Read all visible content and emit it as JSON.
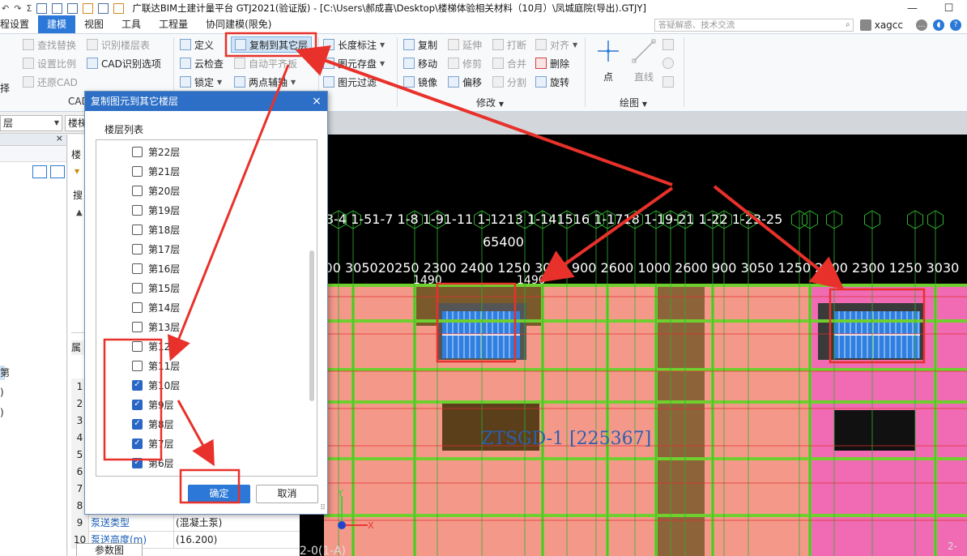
{
  "titlebar": {
    "quick_access": [
      "↶",
      "↷",
      "Σ"
    ],
    "title": "广联达BIM土建计量平台 GTJ2021(验证版) - [C:\\Users\\郝成喜\\Desktop\\楼梯体验相关材料（10月）\\凤城庭院(导出).GTJY]",
    "minimize": "—",
    "maximize": "☐"
  },
  "menubar": {
    "items": [
      "程设置",
      "建模",
      "视图",
      "工具",
      "工程量",
      "协同建模(限免)"
    ],
    "active": "建模",
    "search_placeholder": "答疑解惑、技术交流",
    "search_icon": "search-icon",
    "username": "xagcc"
  },
  "ribbon": {
    "left_partial": [
      "择",
      "择"
    ],
    "cad_group": {
      "find_replace": "查找替换",
      "identify_floors": "识别楼层表",
      "set_scale": "设置比例",
      "cad_options": "CAD识别选项",
      "restore_cad": "还原CAD",
      "label_partial": "CAD"
    },
    "general_group": {
      "define": "定义",
      "copy_to_floor": "复制到其它层",
      "cloud_check": "云检查",
      "auto_align": "自动平齐板",
      "lock": "锁定",
      "two_point_axis": "两点辅轴"
    },
    "mid_group": {
      "length_dim": "长度标注",
      "element_save": "图元存盘",
      "element_filter": "图元过滤"
    },
    "modify_group": {
      "copy": "复制",
      "extend": "延伸",
      "break": "打断",
      "align": "对齐",
      "move": "移动",
      "trim": "修剪",
      "merge": "合并",
      "delete": "删除",
      "mirror": "镜像",
      "offset": "偏移",
      "split": "分割",
      "rotate": "旋转",
      "label": "修改"
    },
    "draw_group": {
      "point": "点",
      "line": "直线",
      "label": "绘图"
    }
  },
  "toolbar2": {
    "floor_combo": "层",
    "type_combo": "楼梯"
  },
  "mid_panel": {
    "header_partial": "楼",
    "search_partial": "搜",
    "attr_header_partial": "属",
    "tree_glyph": "▲"
  },
  "left_panel": {
    "partials": [
      "第",
      ")",
      ")"
    ]
  },
  "properties": {
    "row_numbers": [
      "1",
      "2",
      "3",
      "4",
      "5",
      "6",
      "7",
      "8"
    ],
    "rows": [
      {
        "n": "9",
        "key": "泵送类型",
        "value": "(混凝土泵)"
      },
      {
        "n": "10",
        "key": "泵送高度(m)",
        "value": "(16.200)"
      }
    ],
    "bottom_tab": "参数图"
  },
  "canvas": {
    "axis_labels": [
      "1-3",
      "1-4",
      "1-5",
      "1-6",
      "1-7",
      "1-8",
      "1-9",
      "1-10",
      "1-11",
      "1-12",
      "1-13",
      "1-14",
      "1-15",
      "1-16",
      "1-17",
      "1-18",
      "1-19",
      "1-20",
      "1-21",
      "1-22",
      "1-23",
      "1-24",
      "1-25"
    ],
    "axis_header_row": "1-3-4    1-51-7   1-8   1-91-11    1-1213   1-141516   1-1718    1-19-21   1-22   1-23-25",
    "total_dim": "65400",
    "dims_row": "00900 305020250 2300 2400 1250 3050 900 2600 1000 2600 900 3050 1250 2400 2300 1250 3030",
    "small_dims": [
      "1490",
      "1490"
    ],
    "element_label": "ZTSGD-1 [225367]",
    "bottom_partial": "2-0(1-A)",
    "corner_partial": "2-"
  },
  "dialog": {
    "title": "复制图元到其它楼层",
    "close": "×",
    "list_label": "楼层列表",
    "floors": [
      {
        "name": "第22层",
        "checked": false
      },
      {
        "name": "第21层",
        "checked": false
      },
      {
        "name": "第20层",
        "checked": false
      },
      {
        "name": "第19层",
        "checked": false
      },
      {
        "name": "第18层",
        "checked": false
      },
      {
        "name": "第17层",
        "checked": false
      },
      {
        "name": "第16层",
        "checked": false
      },
      {
        "name": "第15层",
        "checked": false
      },
      {
        "name": "第14层",
        "checked": false
      },
      {
        "name": "第13层",
        "checked": false
      },
      {
        "name": "第12层",
        "checked": false
      },
      {
        "name": "第11层",
        "checked": false
      },
      {
        "name": "第10层",
        "checked": true
      },
      {
        "name": "第9层",
        "checked": true
      },
      {
        "name": "第8层",
        "checked": true
      },
      {
        "name": "第7层",
        "checked": true
      },
      {
        "name": "第6层",
        "checked": true
      }
    ],
    "ok": "确定",
    "cancel": "取消"
  },
  "colors": {
    "accent": "#2b78d8",
    "annotation": "#e8312a",
    "slab_salmon": "#f4998a",
    "slab_pink": "#f06bb4",
    "beam_green": "#6fcf2f",
    "stair_blue": "#2f7fe0",
    "wall_brown": "#7a5a2a"
  }
}
